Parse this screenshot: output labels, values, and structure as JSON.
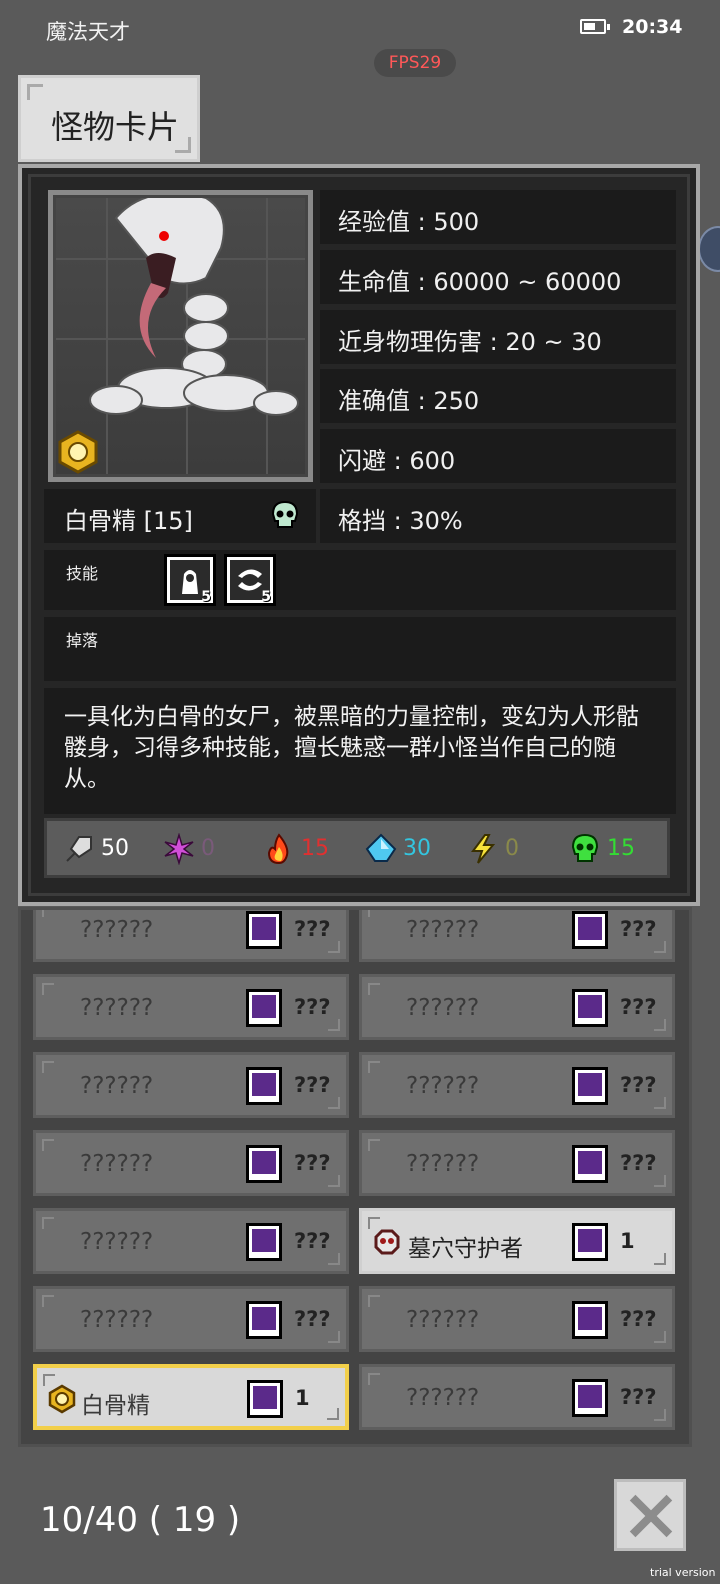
{
  "status_bar": {
    "app_name": "魔法天才",
    "time": "20:34",
    "battery_level": 0.6
  },
  "fps": "FPS29",
  "header": {
    "title": "怪物卡片"
  },
  "monster": {
    "name": "白骨精 [15]",
    "stats": [
      "经验值 : 500",
      "生命值 : 60000 ~ 60000",
      "近身物理伤害 : 20 ~ 30",
      "准确值 : 250",
      "闪避 : 600",
      "格挡 : 30%"
    ],
    "skills_label": "技能",
    "skills": [
      {
        "icon": "hooded-figure-skill-icon",
        "level": "5"
      },
      {
        "icon": "swirl-skill-icon",
        "level": "5"
      }
    ],
    "drops_label": "掉落",
    "description": "一具化为白骨的女尸，被黑暗的力量控制，变幻为人形骷髅身，习得多种技能，擅长魅惑一群小怪当作自己的随从。",
    "resistances": [
      {
        "icon": "physical-icon",
        "value": "50",
        "color": "#ffffff"
      },
      {
        "icon": "magic-icon",
        "value": "0",
        "color": "#7a5a7a"
      },
      {
        "icon": "fire-icon",
        "value": "15",
        "color": "#e03030"
      },
      {
        "icon": "ice-icon",
        "value": "30",
        "color": "#33c6e0"
      },
      {
        "icon": "lightning-icon",
        "value": "0",
        "color": "#8a8a4a"
      },
      {
        "icon": "poison-icon",
        "value": "15",
        "color": "#33dd33"
      }
    ]
  },
  "collection": [
    {
      "name": "??????",
      "count": "???",
      "state": "locked"
    },
    {
      "name": "??????",
      "count": "???",
      "state": "locked"
    },
    {
      "name": "??????",
      "count": "???",
      "state": "locked"
    },
    {
      "name": "??????",
      "count": "???",
      "state": "locked"
    },
    {
      "name": "??????",
      "count": "???",
      "state": "locked"
    },
    {
      "name": "??????",
      "count": "???",
      "state": "locked"
    },
    {
      "name": "??????",
      "count": "???",
      "state": "locked"
    },
    {
      "name": "??????",
      "count": "???",
      "state": "locked"
    },
    {
      "name": "??????",
      "count": "???",
      "state": "locked"
    },
    {
      "name": "墓穴守护者",
      "count": "1",
      "state": "found"
    },
    {
      "name": "??????",
      "count": "???",
      "state": "locked"
    },
    {
      "name": "??????",
      "count": "???",
      "state": "locked"
    },
    {
      "name": "白骨精",
      "count": "1",
      "state": "selected"
    },
    {
      "name": "??????",
      "count": "???",
      "state": "locked"
    }
  ],
  "footer": {
    "progress": "10/40 ( 19 )",
    "watermark": "trial version"
  }
}
